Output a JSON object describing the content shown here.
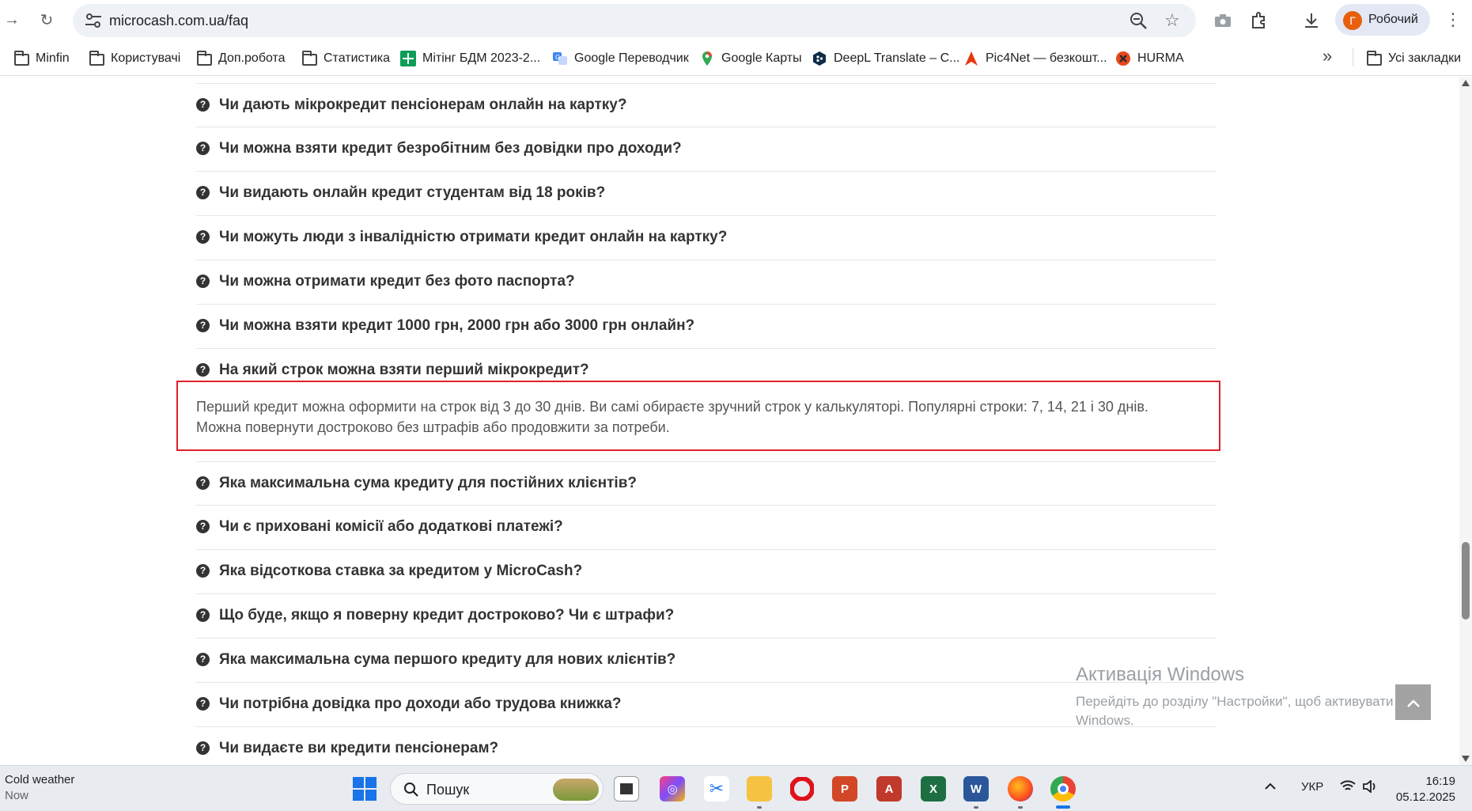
{
  "browser": {
    "url": "microcash.com.ua/faq",
    "profile_initial": "Г",
    "profile_name": "Робочий"
  },
  "bookmarks": [
    {
      "label": "Minfin",
      "icon": "folder-icon"
    },
    {
      "label": "Користувачі",
      "icon": "folder-icon"
    },
    {
      "label": "Доп.робота",
      "icon": "folder-icon"
    },
    {
      "label": "Статистика",
      "icon": "folder-icon"
    },
    {
      "label": "Мітінг БДМ 2023-2...",
      "icon": "sheets-icon"
    },
    {
      "label": "Google Переводчик",
      "icon": "translate-icon"
    },
    {
      "label": "Google Карты",
      "icon": "maps-pin-icon"
    },
    {
      "label": "DeepL Translate – С...",
      "icon": "deepl-icon"
    },
    {
      "label": "Pic4Net — безкошт...",
      "icon": "pic4net-icon"
    },
    {
      "label": "HURMA",
      "icon": "hurma-icon"
    }
  ],
  "all_bookmarks_label": "Усі закладки",
  "faq_before": [
    "Чи дають мікрокредит пенсіонерам онлайн на картку?",
    "Чи можна взяти кредит безробітним без довідки про доходи?",
    "Чи видають онлайн кредит студентам від 18 років?",
    "Чи можуть люди з інвалідністю отримати кредит онлайн на картку?",
    "Чи можна отримати кредит без фото паспорта?",
    "Чи можна взяти кредит 1000 грн, 2000 грн або 3000 грн онлайн?",
    "На який строк можна взяти перший мікрокредит?"
  ],
  "faq_answer": {
    "line1": "Перший кредит можна оформити на строк від 3 до 30 днів. Ви самі обираєте зручний строк у калькуляторі. Популярні строки: 7, 14, 21 і 30 днів.",
    "line2": "Можна повернути достроково без штрафів або продовжити за потреби."
  },
  "faq_after": [
    "Яка максимальна сума кредиту для постійних клієнтів?",
    "Чи є приховані комісії або додаткові платежі?",
    "Яка відсоткова ставка за кредитом у MicroCash?",
    "Що буде, якщо я поверну кредит достроково? Чи є штрафи?",
    "Яка максимальна сума першого кредиту для нових клієнтів?",
    "Чи потрібна довідка про доходи або трудова книжка?",
    "Чи видаєте ви кредити пенсіонерам?"
  ],
  "question_icon_glyph": "?",
  "activation": {
    "title": "Активація Windows",
    "subtitle_line1": "Перейдіть до розділу \"Настройки\", щоб активувати",
    "subtitle_line2": "Windows."
  },
  "taskbar": {
    "weather_title": "Cold weather",
    "weather_sub": "Now",
    "search_label": "Пошук",
    "language": "УКР",
    "time": "16:19",
    "date": "05.12.2025"
  },
  "colors": {
    "highlight_border": "#e0202a",
    "profile_avatar": "#e8600e"
  }
}
